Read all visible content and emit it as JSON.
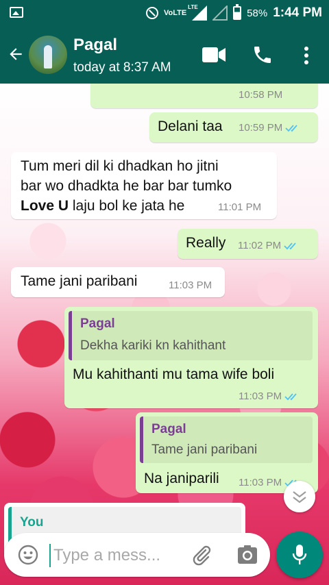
{
  "status_bar": {
    "network_label": "VoLTE",
    "lte_label": "LTE",
    "battery": "58%",
    "time": "1:44 PM"
  },
  "header": {
    "contact_name": "Pagal",
    "last_seen": "today at 8:37 AM"
  },
  "messages": [
    {
      "dir": "out",
      "text": "",
      "time": "10:58 PM"
    },
    {
      "dir": "out",
      "text": "Delani taa",
      "time": "10:59 PM"
    },
    {
      "dir": "in",
      "text_lines": [
        "Tum meri dil ki dhadkan ho jitni",
        "bar wo dhadkta he bar bar tumko"
      ],
      "bold": "Love U",
      "text_after": " laju bol ke jata he",
      "time": "11:01 PM"
    },
    {
      "dir": "out",
      "text": "Really",
      "time": "11:02 PM"
    },
    {
      "dir": "in",
      "text": "Tame jani paribani",
      "time": "11:03 PM"
    },
    {
      "dir": "out",
      "quote_name": "Pagal",
      "quote_text": "Dekha kariki kn kahithant",
      "text": "Mu kahithanti mu tama wife boli",
      "time": "11:03 PM"
    },
    {
      "dir": "out",
      "quote_name": "Pagal",
      "quote_text": "Tame jani paribani",
      "text": "Na janiparili",
      "time": "11:03 PM"
    },
    {
      "dir": "in",
      "quote_name": "You"
    }
  ],
  "composer": {
    "placeholder": "Type a mess..."
  },
  "icons": [
    "image-icon",
    "do-not-disturb-icon",
    "signal-icon",
    "battery-icon",
    "back-arrow-icon",
    "video-call-icon",
    "phone-icon",
    "more-vert-icon",
    "double-check-icon",
    "chevron-down-icon",
    "emoji-icon",
    "attach-icon",
    "camera-icon",
    "mic-icon"
  ],
  "colors": {
    "header": "#075e54",
    "outgoing_bubble": "#dcf8c6",
    "incoming_bubble": "#ffffff",
    "read_ticks": "#4fc3f7",
    "mic_button": "#00897b",
    "quote_accent": "#7b3f92"
  }
}
